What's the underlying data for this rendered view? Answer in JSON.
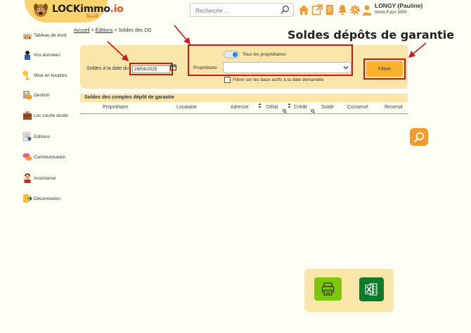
{
  "header": {
    "logo_text": "LOCKimmo",
    "logo_suffix": ".io",
    "logo_sub": "PRO",
    "search_placeholder": "Recherche ...",
    "user_name": "LONGY (Pauline)",
    "user_org": "Immo Futur 3000",
    "icons": [
      "home-icon",
      "external-link-icon",
      "document-icon",
      "bell-icon",
      "gear-icon",
      "user-icon"
    ]
  },
  "sidebar": {
    "items": [
      {
        "label": "Tableau de bord",
        "icon": "dashboard-icon"
      },
      {
        "label": "Vos données",
        "icon": "user-data-icon"
      },
      {
        "label": "Mise en location",
        "icon": "key-icon"
      },
      {
        "label": "Gestion",
        "icon": "gestion-icon"
      },
      {
        "label": "Loc courte durée",
        "icon": "suitcase-icon"
      },
      {
        "label": "Editions",
        "icon": "editions-icon"
      },
      {
        "label": "Communication",
        "icon": "chat-icon"
      },
      {
        "label": "Assistance",
        "icon": "assistance-icon"
      },
      {
        "label": "Déconnexion",
        "icon": "logout-icon"
      }
    ]
  },
  "breadcrumb": {
    "home": "Accueil",
    "sep1": ">",
    "section": "Éditions",
    "sep2": ">",
    "current": "Soldes des DG"
  },
  "page_title": "Soldes dépôts de garantie",
  "filters": {
    "date_label": "Soldes à la date du",
    "date_value": "28/04/2025",
    "all_owners_label": "Tous les propriétaires",
    "all_owners_on": true,
    "owner_label": "Propriétaire",
    "owner_value": "",
    "active_leases_label": "Filtrer sur les baux actifs à la date demandée",
    "active_leases_checked": false,
    "filter_button": "Filtrer"
  },
  "table": {
    "title": "Soldes des comptes dépôt de garantie",
    "columns": [
      "Propriétaire",
      "Locataire",
      "Adresse",
      "Débit",
      "Crédit",
      "Solde",
      "Conservé",
      "Reversé"
    ],
    "rows": []
  },
  "colors": {
    "accent_orange": "#f59a2c",
    "panel_yellow": "#fbe6a9",
    "filter_button": "#fbb22c",
    "annotation_red": "#d01818",
    "print_green": "#7cc80a",
    "excel_green": "#0e7a2c",
    "toggle_blue": "#1e88e5"
  },
  "actions": {
    "search_fab_icon": "search-icon",
    "print_icon": "printer-icon",
    "excel_icon": "excel-icon"
  }
}
